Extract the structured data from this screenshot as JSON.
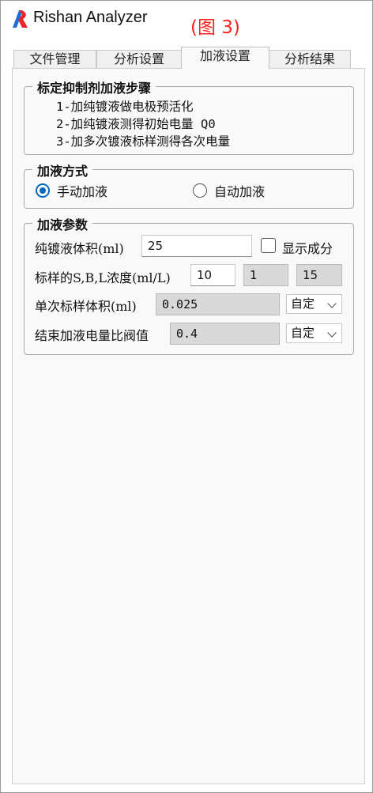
{
  "window": {
    "title": "Rishan Analyzer",
    "figure_tag": "(图 3)"
  },
  "tabs": [
    {
      "label": "文件管理"
    },
    {
      "label": "分析设置"
    },
    {
      "label": "加液设置"
    },
    {
      "label": "分析结果"
    }
  ],
  "steps_group": {
    "title": "标定抑制剂加液步骤",
    "steps": [
      "1-加纯镀液做电极预活化",
      "2-加纯镀液测得初始电量 Q0",
      "3-加多次镀液标样测得各次电量"
    ]
  },
  "mode_group": {
    "title": "加液方式",
    "options": [
      {
        "label": "手动加液",
        "selected": true
      },
      {
        "label": "自动加液",
        "selected": false
      }
    ]
  },
  "params_group": {
    "title": "加液参数",
    "pure_volume": {
      "label": "纯镀液体积(ml)",
      "value": "25"
    },
    "show_components": {
      "label": "显示成分",
      "checked": false
    },
    "concentration": {
      "label": "标样的S,B,L浓度(ml/L)",
      "s": "10",
      "b": "1",
      "l": "15"
    },
    "single_volume": {
      "label": "单次标样体积(ml)",
      "value": "0.025",
      "mode": "自定"
    },
    "end_threshold": {
      "label": "结束加液电量比阀值",
      "value": "0.4",
      "mode": "自定"
    }
  }
}
